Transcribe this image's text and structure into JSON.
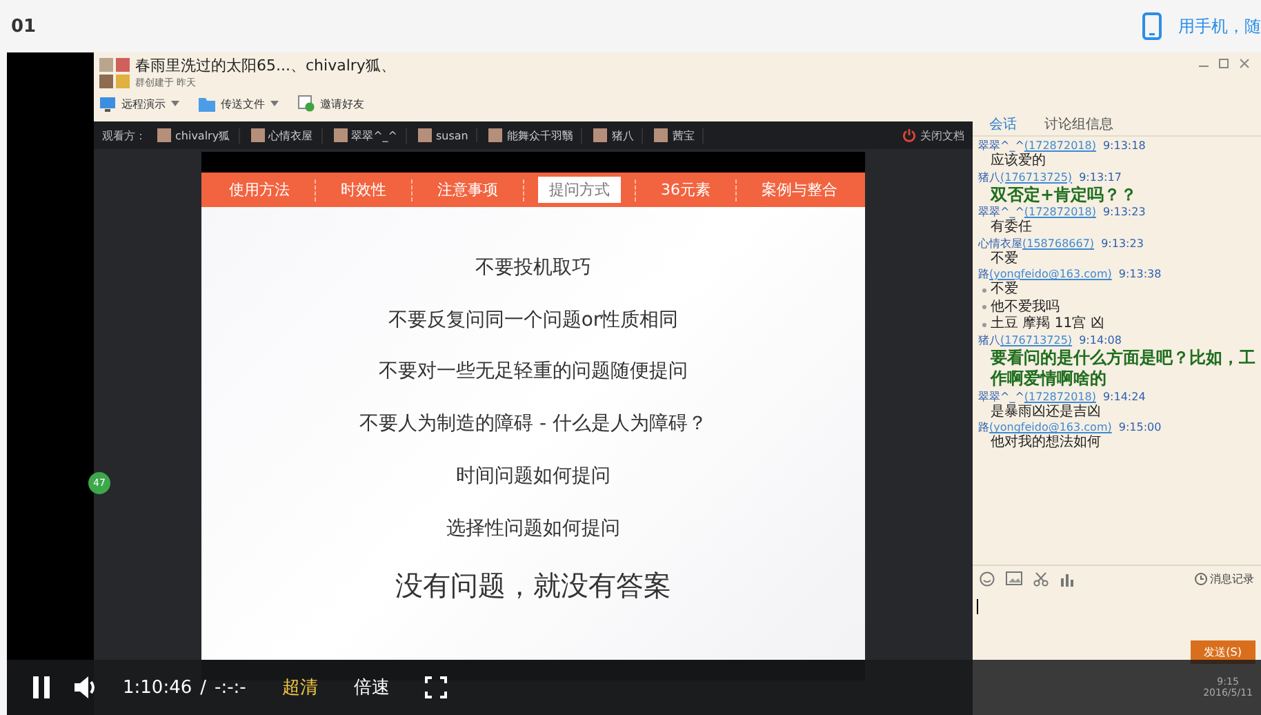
{
  "page_header": {
    "episode": "01",
    "mobile_link": "用手机，随"
  },
  "group": {
    "title": "春雨里洗过的太阳65...、chivalry狐、",
    "subtitle": "群创建于 昨天",
    "toolbar": [
      {
        "label": "远程演示",
        "kind": "screen",
        "dropdown": true
      },
      {
        "label": "传送文件",
        "kind": "folder",
        "dropdown": true
      },
      {
        "label": "邀请好友",
        "kind": "invite",
        "dropdown": false
      }
    ]
  },
  "viewers": {
    "label": "观看方：",
    "names": [
      "chivalry狐",
      "心情衣屋",
      "翠翠^_^",
      "susan",
      "能舞众千羽翳",
      "猪八",
      "茜宝"
    ],
    "close_label": "关闭文档"
  },
  "slide": {
    "tabs": [
      {
        "label": "使用方法",
        "selected": false
      },
      {
        "label": "时效性",
        "selected": false
      },
      {
        "label": "注意事项",
        "selected": false
      },
      {
        "label": "提问方式",
        "selected": true
      },
      {
        "label": "36元素",
        "selected": false
      },
      {
        "label": "案例与整合",
        "selected": false
      }
    ],
    "lines": [
      {
        "text": "不要投机取巧",
        "kind": "normal"
      },
      {
        "text": "不要反复问同一个问题or性质相同",
        "kind": "normal"
      },
      {
        "text": "不要对一些无足轻重的问题随便提问",
        "kind": "normal"
      },
      {
        "text": "不要人为制造的障碍 - 什么是人为障碍？",
        "kind": "normal"
      },
      {
        "text": "时间问题如何提问",
        "kind": "normal"
      },
      {
        "text": "选择性问题如何提问",
        "kind": "normal"
      },
      {
        "text": "没有问题，就没有答案",
        "kind": "headline"
      }
    ]
  },
  "badge": "47",
  "chat": {
    "tabs": [
      {
        "label": "会话",
        "selected": true
      },
      {
        "label": "讨论组信息",
        "selected": false
      }
    ],
    "messages": [
      {
        "name": "翠翠^_^",
        "account": "(172872018)",
        "time": "9:13:18",
        "kind": "plain",
        "lines": [
          "应该爱的"
        ]
      },
      {
        "name": "猪八",
        "account": "(176713725)",
        "time": "9:13:17",
        "kind": "large",
        "lines": [
          "双否定+肯定吗？？"
        ]
      },
      {
        "name": "翠翠^_^",
        "account": "(172872018)",
        "time": "9:13:23",
        "kind": "plain",
        "lines": [
          "有委任"
        ]
      },
      {
        "name": "心情衣屋",
        "account": "(158768667)",
        "time": "9:13:23",
        "kind": "plain",
        "lines": [
          "不爱"
        ]
      },
      {
        "name": "路",
        "account": "(yongfeido@163.com)",
        "time": "9:13:38",
        "kind": "bullet",
        "lines": [
          "不爱",
          "他不爱我吗",
          "土豆 摩羯 11宫 凶"
        ]
      },
      {
        "name": "猪八",
        "account": "(176713725)",
        "time": "9:14:08",
        "kind": "large",
        "lines": [
          "要看问的是什么方面是吧？比如，工作啊爱情啊啥的"
        ]
      },
      {
        "name": "翠翠^_^",
        "account": "(172872018)",
        "time": "9:14:24",
        "kind": "plain",
        "lines": [
          "是暴雨凶还是吉凶"
        ]
      },
      {
        "name": "路",
        "account": "(yongfeido@163.com)",
        "time": "9:15:00",
        "kind": "plain",
        "lines": [
          "他对我的想法如何"
        ]
      }
    ],
    "history_label": "消息记录",
    "send_label": "发送(S)"
  },
  "player": {
    "elapsed": "1:10:46",
    "separator": "/",
    "duration": "-:-:-",
    "quality": "超清",
    "speed": "倍速"
  },
  "taskbar": {
    "time": "9:15",
    "date": "2016/5/11"
  }
}
